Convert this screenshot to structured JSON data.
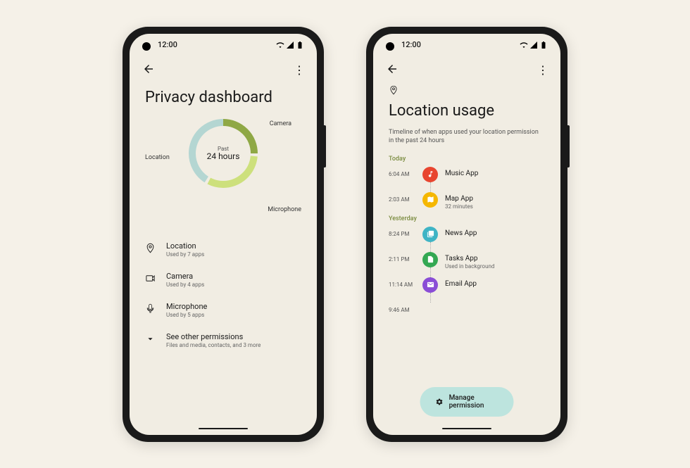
{
  "status": {
    "time": "12:00"
  },
  "phone1": {
    "title": "Privacy dashboard",
    "donut": {
      "small": "Past",
      "big": "24 hours"
    },
    "chart_labels": {
      "camera": "Camera",
      "location": "Location",
      "microphone": "Microphone"
    },
    "permissions": [
      {
        "name": "Location",
        "desc": "Used by 7 apps",
        "icon": "location"
      },
      {
        "name": "Camera",
        "desc": "Used by 4 apps",
        "icon": "camera"
      },
      {
        "name": "Microphone",
        "desc": "Used by 5 apps",
        "icon": "mic"
      }
    ],
    "other": {
      "name": "See other permissions",
      "desc": "Files and media, contacts, and 3 more"
    }
  },
  "phone2": {
    "title": "Location usage",
    "subtitle": "Timeline of when apps used your location permission in the past 24 hours",
    "sections": {
      "today": "Today",
      "yesterday": "Yesterday"
    },
    "timeline": [
      {
        "time": "6:04 AM",
        "name": "Music App",
        "desc": "",
        "color": "#e8452f",
        "icon": "music"
      },
      {
        "time": "2:03 AM",
        "name": "Map App",
        "desc": "32 minutes",
        "color": "#f5b700",
        "icon": "map"
      },
      {
        "time": "8:24 PM",
        "name": "News App",
        "desc": "",
        "color": "#3fb4c5",
        "icon": "news"
      },
      {
        "time": "2:11 PM",
        "name": "Tasks App",
        "desc": "Used in background",
        "color": "#34a853",
        "icon": "tasks"
      },
      {
        "time": "11:14 AM",
        "name": "Email App",
        "desc": "",
        "color": "#8a4dd6",
        "icon": "email"
      },
      {
        "time": "9:46 AM",
        "name": "",
        "desc": "",
        "color": "",
        "icon": ""
      }
    ],
    "manage": "Manage permission"
  },
  "chart_data": {
    "type": "pie",
    "title": "Past 24 hours",
    "series": [
      {
        "name": "Camera",
        "value": 4,
        "color": "#8fa845"
      },
      {
        "name": "Microphone",
        "value": 5,
        "color": "#cde07c"
      },
      {
        "name": "Location",
        "value": 7,
        "color": "#b4d6d2"
      }
    ]
  }
}
